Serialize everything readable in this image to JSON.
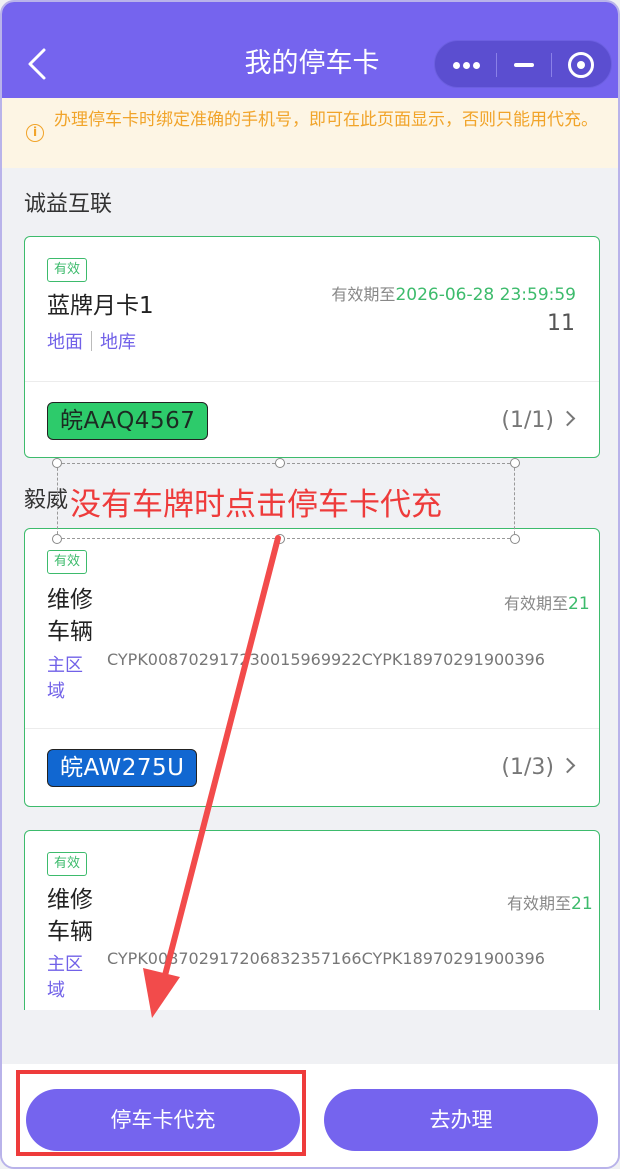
{
  "header": {
    "title": "我的停车卡"
  },
  "notice": {
    "text": "办理停车卡时绑定准确的手机号，即可在此页面显示，否则只能用代充。"
  },
  "groups": [
    {
      "name": "诚益互联",
      "cards": [
        {
          "status": "有效",
          "name": "蓝牌月卡1",
          "areas": [
            "地面",
            "地库"
          ],
          "expiry_prefix": "有效期至",
          "expiry_date": "2026-06-28 23:59:59",
          "number": "11",
          "plate": "皖AAQ4567",
          "plate_color": "#2dcb6b",
          "pager": "(1/1)"
        }
      ]
    },
    {
      "name": "毅威",
      "cards": [
        {
          "status": "有效",
          "name": "维修车辆",
          "area": "主区域",
          "expiry_prefix": "有效期至",
          "expiry_date": "21",
          "code": "CYPK008702917230015969922CYPK18970291900396",
          "plate": "皖AW275U",
          "plate_color": "#1167d1",
          "pager": "(1/3)"
        },
        {
          "status": "有效",
          "name": "维修车辆",
          "area": "主区域",
          "expiry_prefix": "有效期至",
          "expiry_date": "21",
          "code": "CYPK008702917206832357166CYPK18970291900396"
        }
      ]
    }
  ],
  "annotation": {
    "text": "没有车牌时点击停车卡代充",
    "color": "#ee3b3b"
  },
  "footer": {
    "recharge_label": "停车卡代充",
    "apply_label": "去办理"
  },
  "colors": {
    "primary": "#7564ee",
    "valid_green": "#3dbb6c",
    "warning": "#f1a42a"
  }
}
